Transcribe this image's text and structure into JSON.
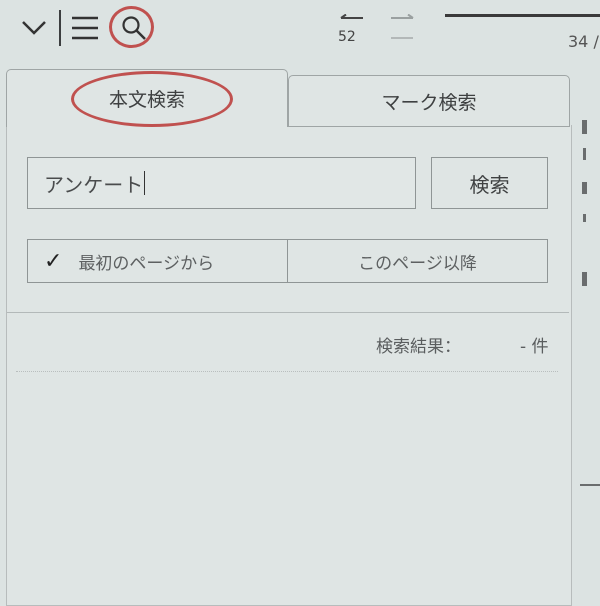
{
  "toolbar": {
    "collapse_icon": "chevron-down-icon",
    "menu_icon": "hamburger-menu-icon",
    "search_icon": "search-icon",
    "back_page_number": "52",
    "current_page": "34 /"
  },
  "tabs": [
    {
      "label": "本文検索",
      "selected": true
    },
    {
      "label": "マーク検索",
      "selected": false
    }
  ],
  "search": {
    "value": "アンケート",
    "button_label": "検索"
  },
  "scope": {
    "options": [
      {
        "label": "最初のページから",
        "checked": true
      },
      {
        "label": "このページ以降",
        "checked": false
      }
    ]
  },
  "results": {
    "label": "検索結果：",
    "count": "- 件"
  },
  "colors": {
    "highlight": "#c0514f",
    "background": "#dce3e2"
  }
}
